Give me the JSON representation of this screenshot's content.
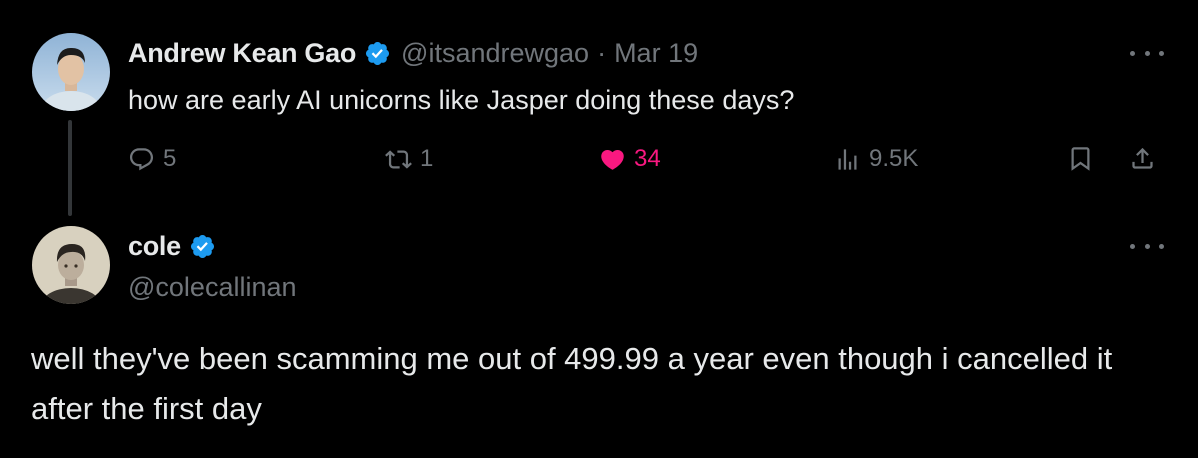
{
  "tweet": {
    "author_name": "Andrew Kean Gao",
    "handle": "@itsandrewgao",
    "separator": "·",
    "date": "Mar 19",
    "text": "how are early AI unicorns like Jasper doing these days?",
    "stats": {
      "replies": "5",
      "retweets": "1",
      "likes": "34",
      "views": "9.5K"
    },
    "liked": true,
    "verified": true
  },
  "reply": {
    "author_name": "cole",
    "handle": "@colecallinan",
    "text": "well they've been scamming me out of 499.99 a year even though i cancelled it after the first day",
    "verified": true
  },
  "colors": {
    "background": "#000000",
    "text": "#e7e9ea",
    "muted": "#71767b",
    "like_pink": "#f91880",
    "verified_blue": "#1d9bf0",
    "thread_line": "#333639"
  },
  "icons": {
    "reply": "comment-bubble-icon",
    "retweet": "retweet-icon",
    "like": "heart-icon",
    "views": "analytics-bars-icon",
    "bookmark": "bookmark-icon",
    "share": "share-icon",
    "more": "more-dots-icon",
    "verified": "verified-badge-icon"
  }
}
